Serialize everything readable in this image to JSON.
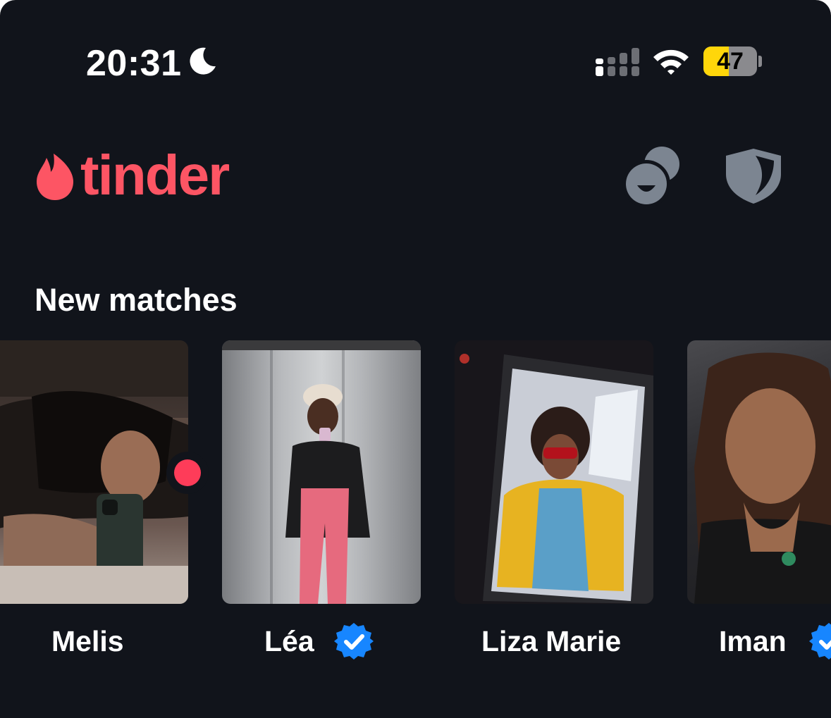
{
  "status_bar": {
    "time": "20:31",
    "battery_level": 47,
    "battery_text": "47",
    "icons": [
      "moon-icon",
      "cellular-signal-icon",
      "wifi-icon",
      "battery-icon"
    ]
  },
  "header": {
    "logo_text": "tinder",
    "brand_color": "#fd5564",
    "actions": [
      "explore-icon",
      "safety-shield-icon"
    ]
  },
  "new_matches": {
    "title": "New matches",
    "matches": [
      {
        "name": "Melis",
        "verified": false,
        "unread": true
      },
      {
        "name": "Léa",
        "verified": true,
        "unread": false
      },
      {
        "name": "Liza Marie",
        "verified": false,
        "unread": false
      },
      {
        "name": "Iman",
        "verified": true,
        "unread": false
      }
    ]
  },
  "colors": {
    "background": "#11141b",
    "text": "#ffffff",
    "icon_gray": "#7c8591",
    "verified_blue": "#1786ff",
    "unread_red": "#fe3c59",
    "battery_yellow": "#ffd60a"
  }
}
